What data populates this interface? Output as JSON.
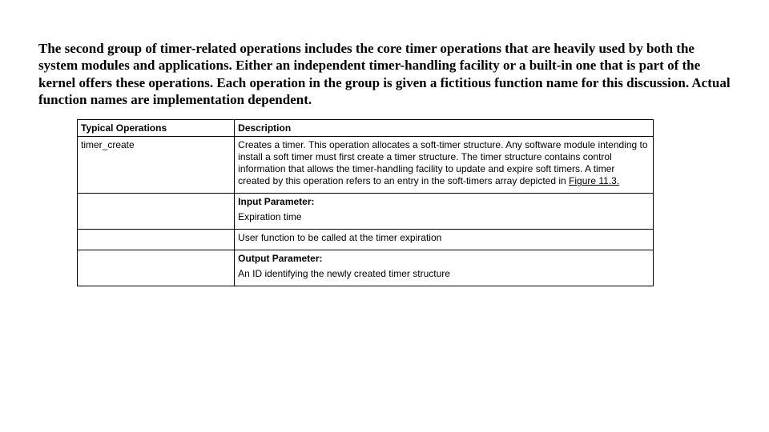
{
  "intro": "The second group of timer-related operations includes the core timer operations that are heavily used by both the system modules and applications. Either an independent timer-handling facility or a built-in one that is part of the kernel offers these operations. Each operation in the group is given a fictitious function name for this discussion. Actual function names are implementation dependent.",
  "table": {
    "header": {
      "ops": "Typical Operations",
      "desc": "Description"
    },
    "rows": [
      {
        "op": "timer_create",
        "desc_pre": "Creates a timer. This operation allocates a soft-timer structure. Any software module intending to install a soft timer must first create a timer structure. The timer structure contains control information that allows the timer-handling facility to update and expire soft timers. A timer created by this operation refers to an entry in the soft-timers array depicted in ",
        "desc_link": "Figure 11.3.",
        "desc_post": ""
      },
      {
        "op": "",
        "sub": "Input Parameter:",
        "desc": "Expiration time"
      },
      {
        "op": "",
        "desc": "User function to be called at the timer expiration"
      },
      {
        "op": "",
        "sub": "Output Parameter:",
        "desc": "An ID identifying the newly created timer structure"
      }
    ]
  }
}
